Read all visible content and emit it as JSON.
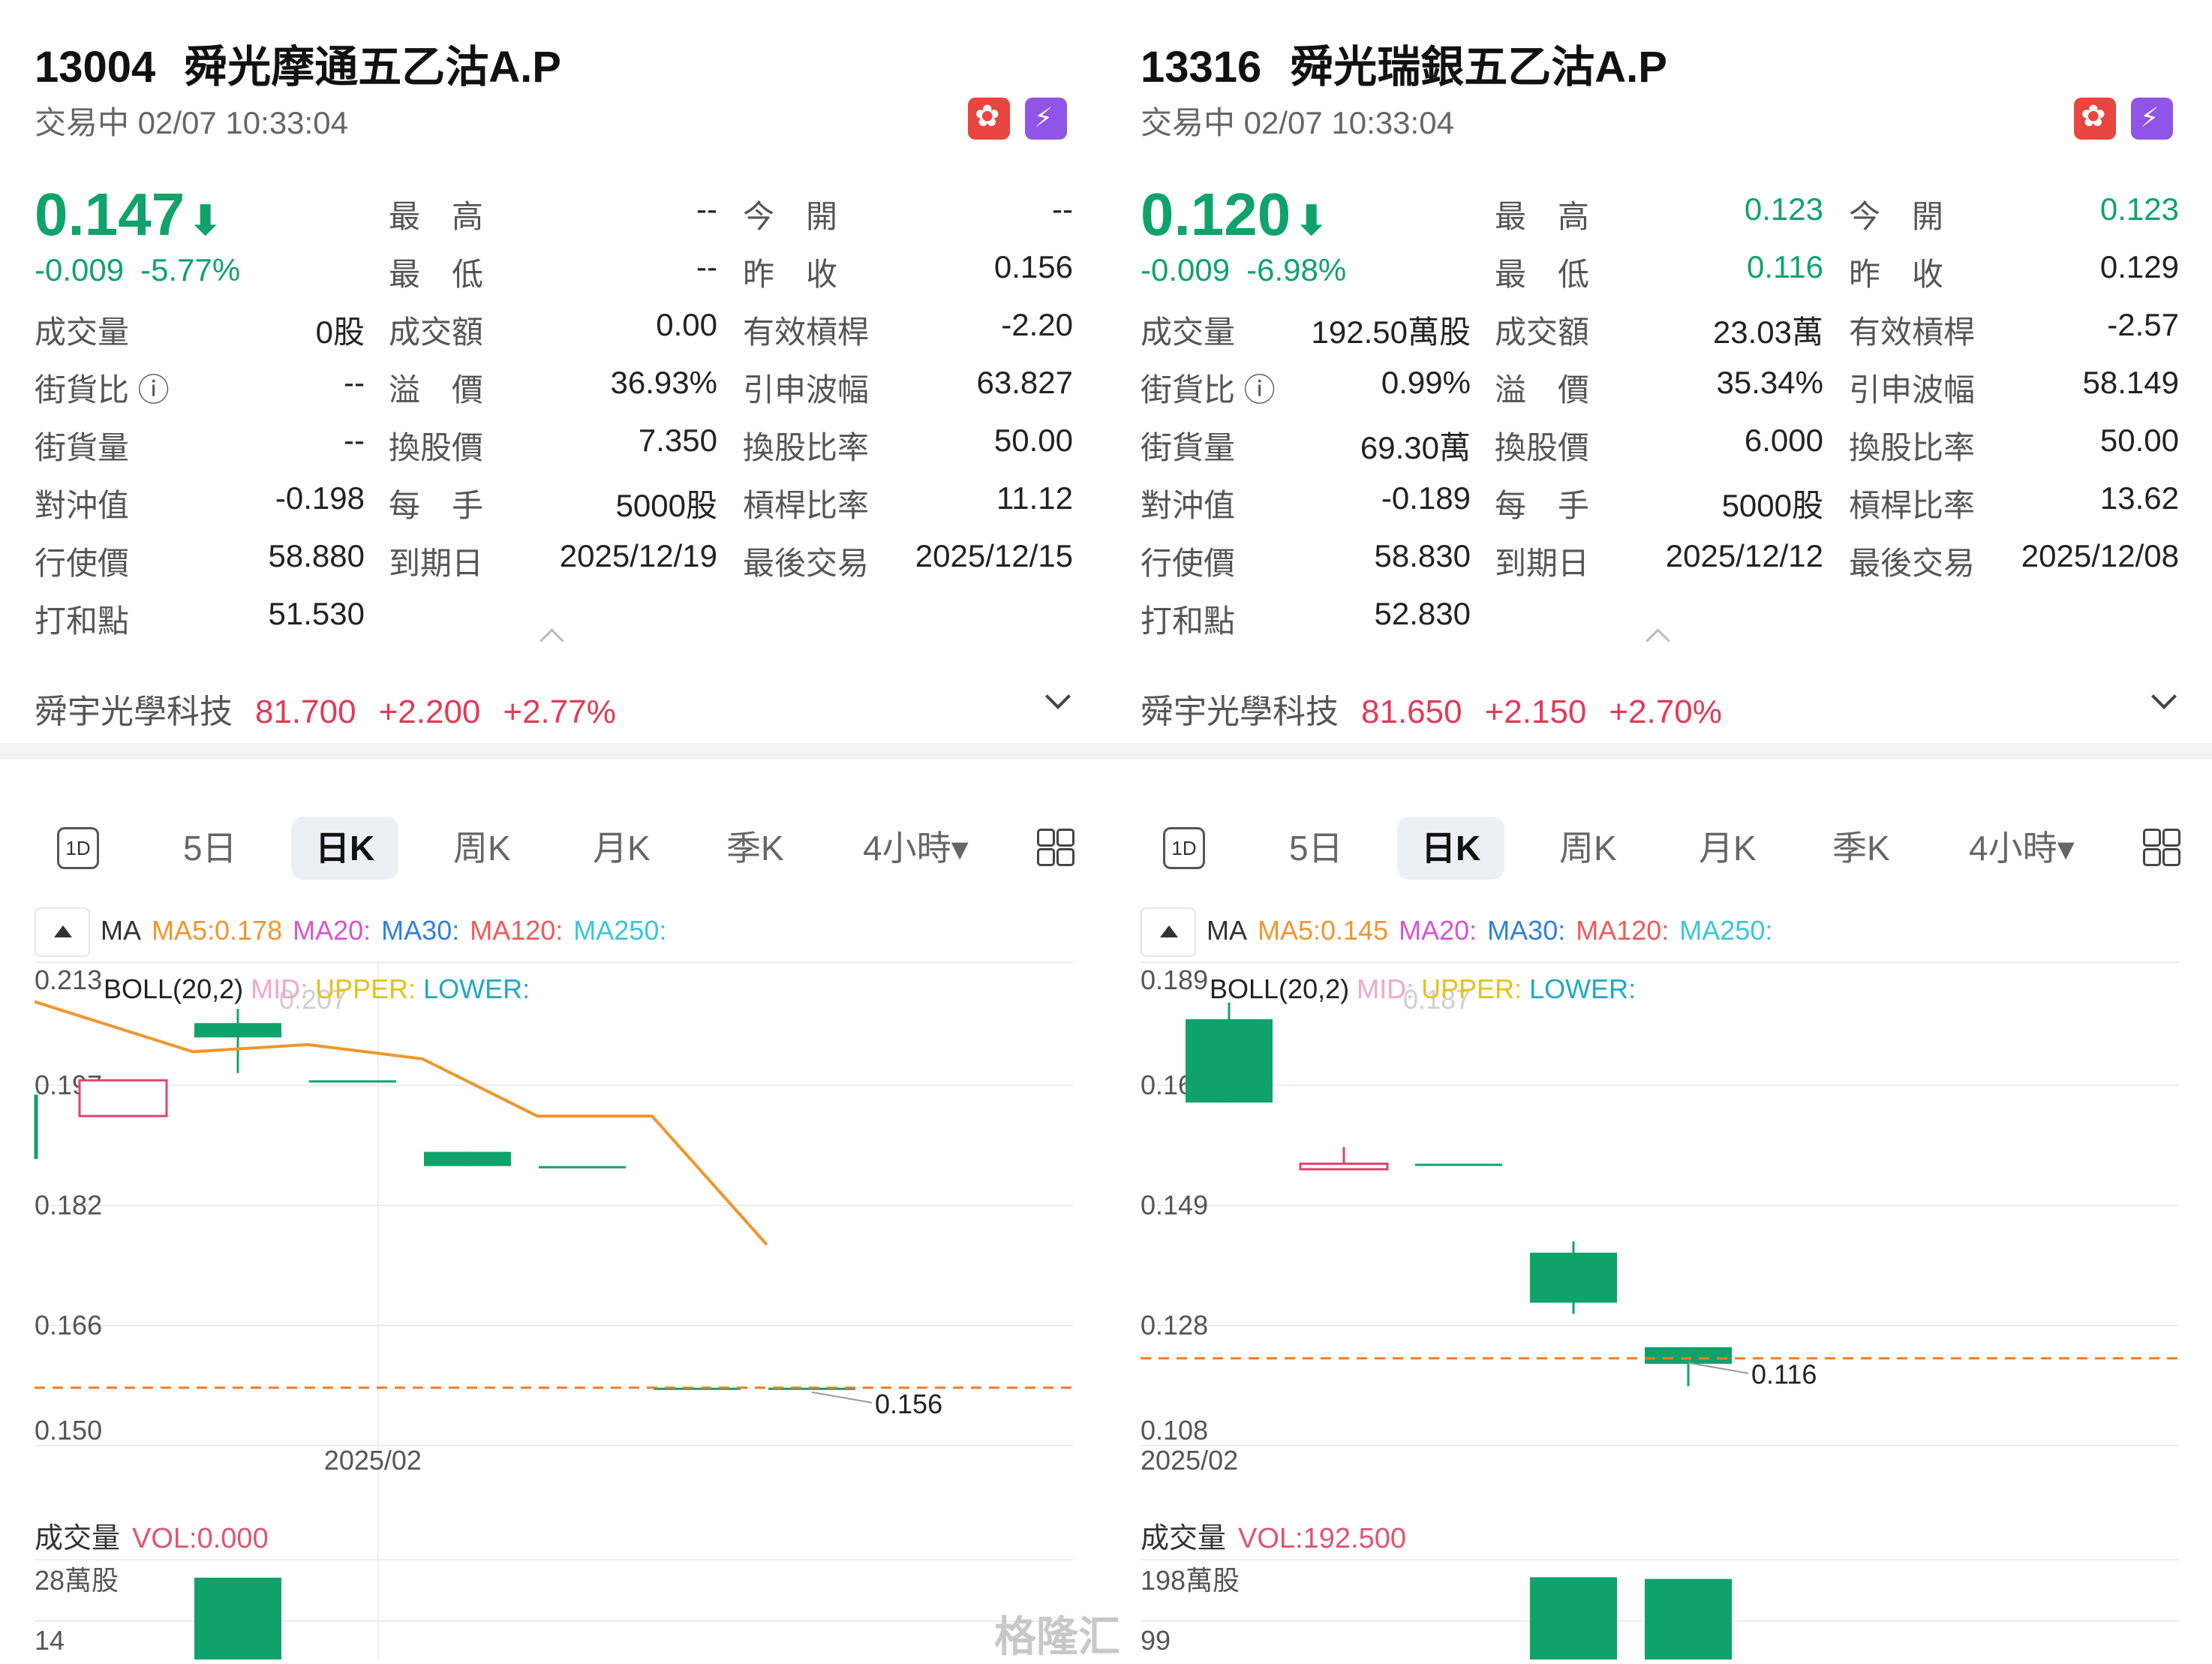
{
  "watermark": "格隆汇",
  "warrants": [
    {
      "code": "13004",
      "name": "舜光摩通五乙沽A.P",
      "status": "交易中 02/07 10:33:04",
      "price": "0.147",
      "change": "-0.009",
      "change_pct": "-5.77%",
      "fields": [
        [
          [
            "最　高",
            "--",
            ""
          ],
          [
            "今　開",
            "--",
            ""
          ]
        ],
        [
          [
            "最　低",
            "--",
            ""
          ],
          [
            "昨　收",
            "0.156",
            ""
          ]
        ],
        [
          [
            "成交量",
            "0股",
            ""
          ],
          [
            "成交額",
            "0.00",
            ""
          ],
          [
            "有效槓桿",
            "-2.20",
            ""
          ]
        ],
        [
          [
            "街貨比 ⓘ",
            "--",
            ""
          ],
          [
            "溢　價",
            "36.93%",
            ""
          ],
          [
            "引申波幅",
            "63.827",
            ""
          ]
        ],
        [
          [
            "街貨量",
            "--",
            ""
          ],
          [
            "換股價",
            "7.350",
            ""
          ],
          [
            "換股比率",
            "50.00",
            ""
          ]
        ],
        [
          [
            "對沖值",
            "-0.198",
            ""
          ],
          [
            "每　手",
            "5000股",
            ""
          ],
          [
            "槓桿比率",
            "11.12",
            ""
          ]
        ],
        [
          [
            "行使價",
            "58.880",
            ""
          ],
          [
            "到期日",
            "2025/12/19",
            ""
          ],
          [
            "最後交易",
            "2025/12/15",
            ""
          ]
        ],
        [
          [
            "打和點",
            "51.530",
            ""
          ]
        ]
      ],
      "underlying": {
        "name": "舜宇光學科技",
        "price": "81.700",
        "change": "+2.200",
        "change_pct": "+2.77%"
      },
      "tabs": [
        "1D",
        "5日",
        "日K",
        "周K",
        "月K",
        "季K",
        "4小時▾"
      ],
      "selected_tab": "日K",
      "ma": {
        "ma_label": "MA",
        "ma5": "MA5:0.178",
        "ma20": "MA20:",
        "ma30": "MA30:",
        "ma120": "MA120:",
        "ma250": "MA250:"
      },
      "boll": {
        "label": "BOLL(20,2)",
        "mid": "MID:",
        "upper": "UPPER:",
        "lower": "LOWER:"
      },
      "chart_data": {
        "type": "candlestick",
        "yticks": [
          "0.213",
          "0.197",
          "0.182",
          "0.166",
          "0.150"
        ],
        "ylim": [
          0.15,
          0.213
        ],
        "xlabel_tick": "2025/02",
        "x_tick_index": 2.6,
        "candles": [
          {
            "open": 0.199,
            "high": 0.199,
            "low": 0.194,
            "close": 0.194,
            "color": "red"
          },
          {
            "open": 0.207,
            "high": 0.209,
            "low": 0.2,
            "close": 0.205,
            "color": "green"
          },
          {
            "open": 0.199,
            "high": 0.199,
            "low": 0.199,
            "close": 0.199,
            "color": "green"
          },
          {
            "open": 0.189,
            "high": 0.189,
            "low": 0.187,
            "close": 0.187,
            "color": "green"
          },
          {
            "open": 0.187,
            "high": 0.187,
            "low": 0.187,
            "close": 0.187,
            "color": "green"
          },
          {
            "open": 0.156,
            "high": 0.156,
            "low": 0.156,
            "close": 0.156,
            "color": "green"
          },
          {
            "open": 0.156,
            "high": 0.156,
            "low": 0.156,
            "close": 0.156,
            "color": "green"
          }
        ],
        "edge_candle": {
          "high": 0.197,
          "low": 0.188
        },
        "ma5_line": [
          0.21,
          0.203,
          0.204,
          0.202,
          0.194,
          0.194,
          0.176
        ],
        "last_close": 0.156,
        "last_close_label": "0.156",
        "high_label": "0.207",
        "volume": {
          "title": "成交量",
          "vol_label": "VOL:0.000",
          "yticks": [
            "28萬股",
            "14"
          ],
          "ymax": 28,
          "values": [
            0,
            28,
            0,
            0,
            0,
            0,
            0
          ]
        }
      }
    },
    {
      "code": "13316",
      "name": "舜光瑞銀五乙沽A.P",
      "status": "交易中 02/07 10:33:04",
      "price": "0.120",
      "change": "-0.009",
      "change_pct": "-6.98%",
      "fields": [
        [
          [
            "最　高",
            "0.123",
            "green"
          ],
          [
            "今　開",
            "0.123",
            "green"
          ]
        ],
        [
          [
            "最　低",
            "0.116",
            "green"
          ],
          [
            "昨　收",
            "0.129",
            ""
          ]
        ],
        [
          [
            "成交量",
            "192.50萬股",
            ""
          ],
          [
            "成交額",
            "23.03萬",
            ""
          ],
          [
            "有效槓桿",
            "-2.57",
            ""
          ]
        ],
        [
          [
            "街貨比 ⓘ",
            "0.99%",
            ""
          ],
          [
            "溢　價",
            "35.34%",
            ""
          ],
          [
            "引申波幅",
            "58.149",
            ""
          ]
        ],
        [
          [
            "街貨量",
            "69.30萬",
            ""
          ],
          [
            "換股價",
            "6.000",
            ""
          ],
          [
            "換股比率",
            "50.00",
            ""
          ]
        ],
        [
          [
            "對沖值",
            "-0.189",
            ""
          ],
          [
            "每　手",
            "5000股",
            ""
          ],
          [
            "槓桿比率",
            "13.62",
            ""
          ]
        ],
        [
          [
            "行使價",
            "58.830",
            ""
          ],
          [
            "到期日",
            "2025/12/12",
            ""
          ],
          [
            "最後交易",
            "2025/12/08",
            ""
          ]
        ],
        [
          [
            "打和點",
            "52.830",
            ""
          ]
        ]
      ],
      "underlying": {
        "name": "舜宇光學科技",
        "price": "81.650",
        "change": "+2.150",
        "change_pct": "+2.70%"
      },
      "tabs": [
        "1D",
        "5日",
        "日K",
        "周K",
        "月K",
        "季K",
        "4小時▾"
      ],
      "selected_tab": "日K",
      "ma": {
        "ma_label": "MA",
        "ma5": "MA5:0.145",
        "ma20": "MA20:",
        "ma30": "MA30:",
        "ma120": "MA120:",
        "ma250": "MA250:"
      },
      "boll": {
        "label": "BOLL(20,2)",
        "mid": "MID:",
        "upper": "UPPER:",
        "lower": "LOWER:"
      },
      "chart_data": {
        "type": "candlestick",
        "yticks": [
          "0.189",
          "0.169",
          "0.149",
          "0.128",
          "0.108"
        ],
        "ylim": [
          0.108,
          0.189
        ],
        "xlabel_tick": "2025/02",
        "x_tick_index": 0,
        "candles": [
          {
            "open": 0.182,
            "high": 0.185,
            "low": 0.167,
            "close": 0.167,
            "color": "green"
          },
          {
            "open": 0.156,
            "high": 0.159,
            "low": 0.155,
            "close": 0.155,
            "color": "red"
          },
          {
            "open": 0.156,
            "high": 0.156,
            "low": 0.156,
            "close": 0.156,
            "color": "green"
          },
          {
            "open": 0.14,
            "high": 0.142,
            "low": 0.129,
            "close": 0.131,
            "color": "green"
          },
          {
            "open": 0.123,
            "high": 0.123,
            "low": 0.116,
            "close": 0.12,
            "color": "green"
          }
        ],
        "last_close": 0.121,
        "last_close_label": "0.116",
        "high_label": "0.187",
        "volume": {
          "title": "成交量",
          "vol_label": "VOL:192.500",
          "yticks": [
            "198萬股",
            "99"
          ],
          "ymax": 198,
          "values": [
            0,
            0,
            0,
            200,
            192.5
          ]
        }
      }
    }
  ]
}
